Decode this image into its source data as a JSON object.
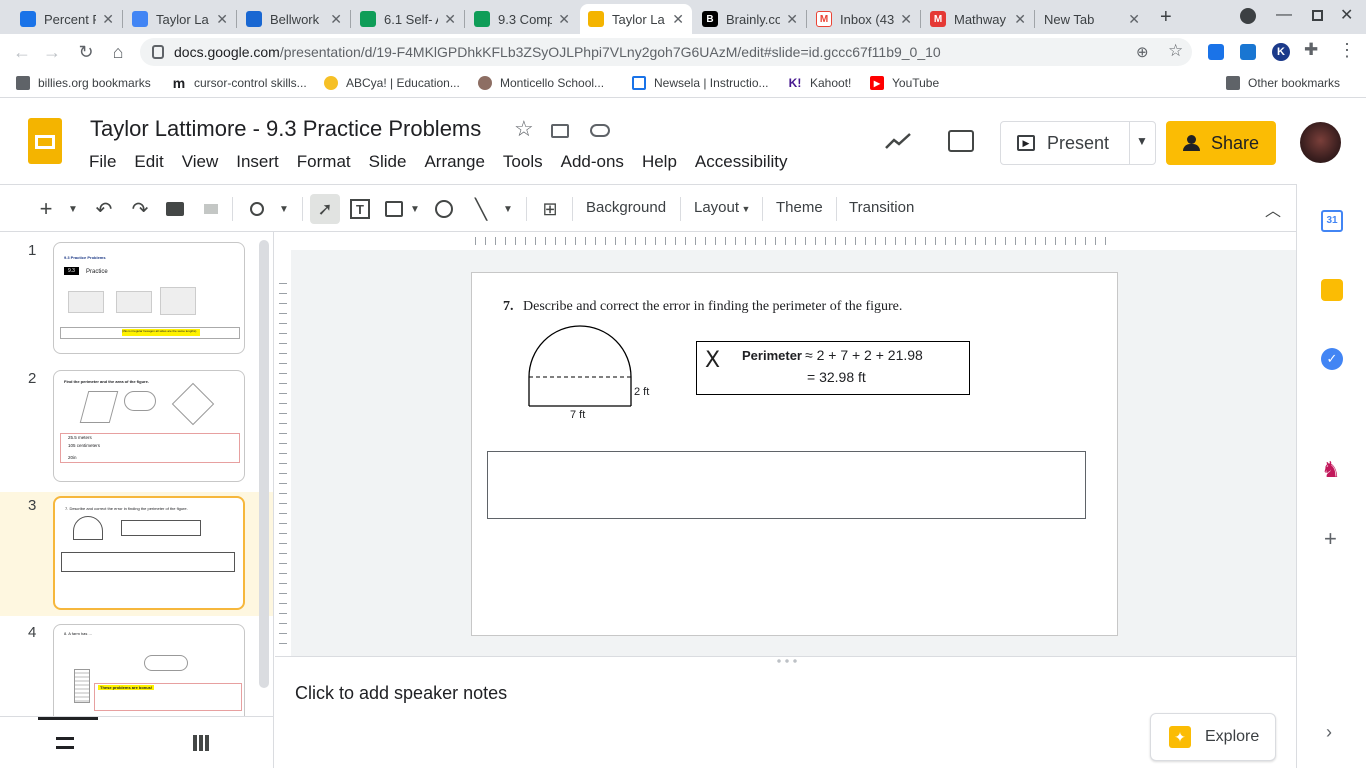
{
  "browser": {
    "tabs": [
      {
        "title": "Percent F",
        "fav": "classroom-icon",
        "color": "#1a73e8"
      },
      {
        "title": "Taylor La",
        "fav": "docs-icon",
        "color": "#4285f4"
      },
      {
        "title": "Bellwork",
        "fav": "classroom-icon",
        "color": "#1967d2"
      },
      {
        "title": "6.1 Self- A",
        "fav": "classroom-icon",
        "color": "#0f9d58"
      },
      {
        "title": "9.3 Comp",
        "fav": "classroom-icon",
        "color": "#0f9d58"
      },
      {
        "title": "Taylor La",
        "fav": "slides-icon",
        "color": "#f4b400",
        "active": true
      },
      {
        "title": "Brainly.co",
        "fav": "brainly-icon",
        "color": "#000000"
      },
      {
        "title": "Inbox (43",
        "fav": "gmail-icon",
        "color": "#ea4335"
      },
      {
        "title": "Mathway",
        "fav": "mathway-icon",
        "color": "#e53935"
      },
      {
        "title": "New Tab",
        "fav": "",
        "color": ""
      }
    ],
    "new_tab_symbol": "+",
    "url_domain": "docs.google.com",
    "url_path": "/presentation/d/19-F4MKlGPDhkKFLb3ZSyOJLPhpi7VLny2goh7G6UAzM/edit#slide=id.gccc67f11b9_0_10",
    "bookmarks": [
      {
        "label": "billies.org bookmarks"
      },
      {
        "label": "cursor-control skills..."
      },
      {
        "label": "ABCya! | Education..."
      },
      {
        "label": "Monticello School..."
      },
      {
        "label": "Newsela | Instructio..."
      },
      {
        "label": "Kahoot!"
      },
      {
        "label": "YouTube"
      }
    ],
    "other_bookmarks": "Other bookmarks"
  },
  "doc": {
    "title": "Taylor Lattimore - 9.3 Practice Problems",
    "menu": [
      "File",
      "Edit",
      "View",
      "Insert",
      "Format",
      "Slide",
      "Arrange",
      "Tools",
      "Add-ons",
      "Help",
      "Accessibility"
    ],
    "present_label": "Present",
    "share_label": "Share"
  },
  "toolbar": {
    "background": "Background",
    "layout": "Layout",
    "theme": "Theme",
    "transition": "Transition"
  },
  "filmstrip": {
    "slides": [
      {
        "number": "1",
        "title": "9.3 Practice Problems",
        "badge": "9.3",
        "heading": "Practice",
        "answer_note": "(this is irregular hexagon all sides are the same lengths)"
      },
      {
        "number": "2",
        "title": "Find the perimeter and the area of the figure.",
        "answers": [
          "25.5 meters",
          "105 centimeters",
          "20in"
        ]
      },
      {
        "number": "3",
        "title": "7. Describe and correct the error in finding the perimeter of the figure."
      },
      {
        "number": "4",
        "title": "8. A farm has ...",
        "note": "These problems are bonus!"
      }
    ],
    "selected": 3
  },
  "slide": {
    "problem_number": "7.",
    "problem_text": "Describe and correct the error in finding the perimeter of the figure.",
    "dim_width": "7 ft",
    "dim_height": "2 ft",
    "mark": "X",
    "perimeter_label": "Perimeter",
    "perimeter_line1": "≈ 2 + 7 + 2 + 21.98",
    "perimeter_line2": "= 32.98 ft",
    "answer_box": ""
  },
  "notes": {
    "placeholder": "Click to add speaker notes"
  },
  "explore_label": "Explore",
  "colors": {
    "slides_yellow": "#f4b400",
    "share_yellow": "#fbbc04",
    "selection_border": "#f6b73c"
  }
}
